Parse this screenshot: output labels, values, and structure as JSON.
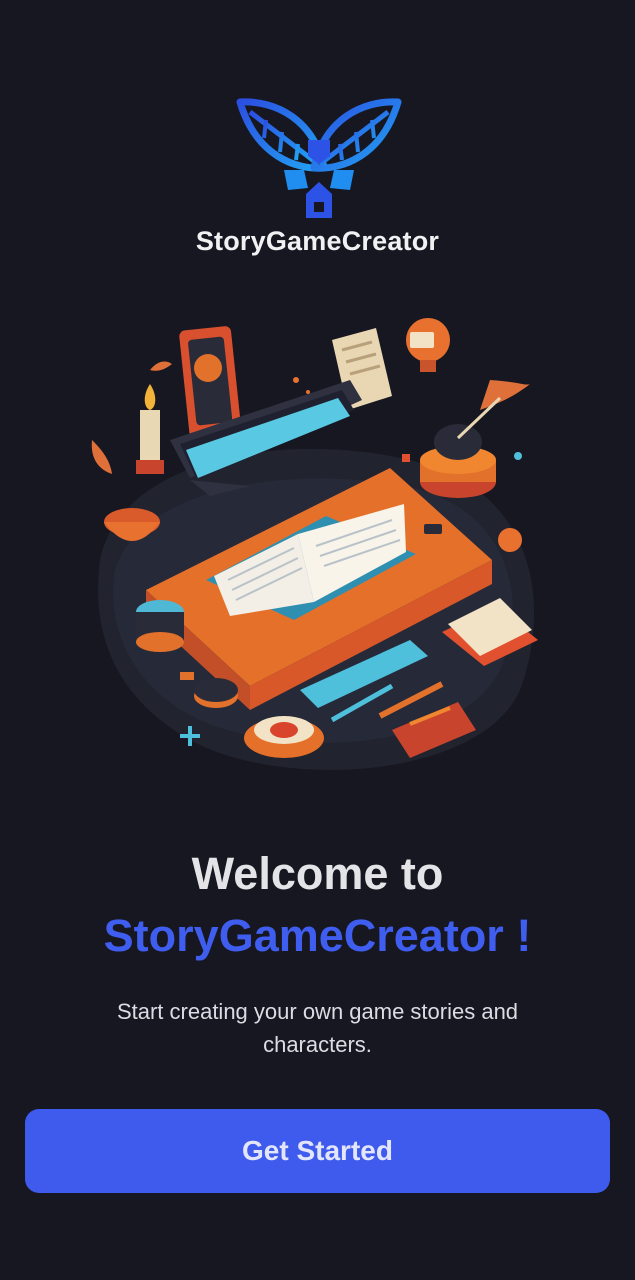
{
  "app": {
    "brand_name": "StoryGameCreator"
  },
  "logo": {
    "icon": "leaf-wings-pen-logo-icon",
    "colors": [
      "#2f56e8",
      "#1fa6f0"
    ]
  },
  "hero": {
    "icon": "isometric-desk-book-computer-illustration"
  },
  "welcome": {
    "line1": "Welcome to",
    "line2": "StoryGameCreator !",
    "subtitle": "Start creating your own game stories and characters."
  },
  "cta": {
    "label": "Get Started"
  },
  "colors": {
    "background": "#171721",
    "accent": "#3f5bed",
    "orange": "#f0862f"
  }
}
